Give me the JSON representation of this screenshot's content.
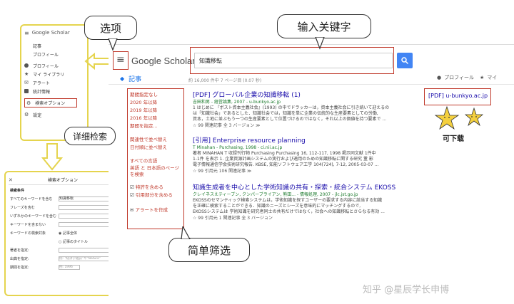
{
  "annotations": {
    "options": "选项",
    "search_keywords": "输入关键字",
    "advanced_search": "详细检索",
    "downloadable": "可下载",
    "simple_filter": "简单筛选"
  },
  "watermark": "知乎 @星辰学长申博",
  "sidebar_menu": {
    "logo": "Google Scholar",
    "items": [
      {
        "label": "記事",
        "icon": ""
      },
      {
        "label": "プロフィール",
        "icon": ""
      },
      {
        "label": "プロフィール",
        "icon": "person-icon"
      },
      {
        "label": "マイ ライブラリ",
        "icon": "star-icon"
      },
      {
        "label": "アラート",
        "icon": "mail-icon"
      },
      {
        "label": "統計情報",
        "icon": "chart-icon"
      },
      {
        "label": "検索オプション",
        "icon": "settings-search-icon"
      },
      {
        "label": "設定",
        "icon": "gear-icon"
      }
    ]
  },
  "header": {
    "logo": "Google Scholar",
    "search_value": "知識移転",
    "profile_label": "プロフィール",
    "my_label": "マイ"
  },
  "results_header": {
    "tab": "記事",
    "count": "約 16,000 件中 7 ページ目 (0.07 秒)"
  },
  "filters": {
    "time": [
      "期間指定なし",
      "2020 年以降",
      "2019 年以降",
      "2016 年以降",
      "期間を指定..."
    ],
    "sort": [
      "関連性で並べ替え",
      "日付順に並べ替え"
    ],
    "lang": [
      "すべての言語",
      "英語 と 日本語のページを検索"
    ],
    "checks": [
      "特許を含める",
      "引用部分を含める"
    ],
    "alert": "アラートを作成"
  },
  "results": [
    {
      "title": "[PDF] グローバル企業の知識移転 (1)",
      "meta": "吉田和男 - 経営論集, 2007 - u-bunkyo.ac.jp",
      "snippet1": "1 はじめに 『ポスト資本主義社会』(1993) の中でドラッカーは，資本主義社会に引き続いて迎えるの",
      "snippet2": "は「知識社会」であるとした．知識社会では，知識を単に企業の伝統的な生産要素としての労働,",
      "snippet3": "資本，土地に並ぶもう一つの生産要素として位置づけるのではなく，それ以上の価値を持つ要素で ...",
      "links": "☆  99  関連記事  全 3 バージョン  ≫",
      "side": "[PDF] u-bunkyo.ac.jp"
    },
    {
      "title": "[引用] Enterprise resource planning",
      "meta": "T Minahan - Purchasing, 1998 - ci.nii.ac.jp",
      "snippet1": "著者 MINAHAN T 収録刊行物 Purchasing Purchasing 16, 112-117, 1998 掲示同文献 1件中",
      "snippet2": "1-1件 を表示 1. 企業資源計画システムの実行および適用のための知識移転に関する研究 董 影",
      "snippet3": "電子情報通信学会技術研究報告. KBSE, 知能ソフトウェア工学 104(724), 7-12, 2005-03-07 ...",
      "links": "☆  99  引用元 106  関連記事  ≫",
      "side": ""
    },
    {
      "title": "知識生成者を中心とした学術知識の共有・探索・統合システム EKOSS",
      "meta": "クレイネスえティーブン, クンパーブライアン, 熊田... - 情報処理, 2007 - jlc.jst.go.jp",
      "snippet1": "EKOSSのセマンティック検索システムは，学術知識を探すユーザーの要求する内容に該当する知識",
      "snippet2": "を正確に検索することができる．知識のニーズとシーズを意味的にマッチングするので,",
      "snippet3": "EKOSSシステムは 学術知識を研究者同士の共有だけではなく，社会への知識移転とさらなる有効 ...",
      "links": "☆  99  引用元 1  関連記事  全 3 バージョン",
      "side": ""
    }
  ],
  "advanced_dialog": {
    "title": "検索オプション",
    "section": "検索条件",
    "rows": [
      {
        "label": "すべてのキーワードを含む",
        "value": "知識移転"
      },
      {
        "label": "フレーズを含む",
        "value": ""
      },
      {
        "label": "いずれかのキーワードを含む",
        "value": ""
      },
      {
        "label": "キーワードを含まない",
        "value": ""
      },
      {
        "label": "キーワードの検索対象",
        "value": "記事全体"
      },
      {
        "label": "",
        "value": "記事のタイトル"
      },
      {
        "label": "著者を指定:",
        "value": ""
      },
      {
        "label": "出典を指定:",
        "value": "例: \"経済学雑誌\"や\"Nature\""
      },
      {
        "label": "期間を指定:",
        "value": "例: 1996"
      }
    ]
  }
}
